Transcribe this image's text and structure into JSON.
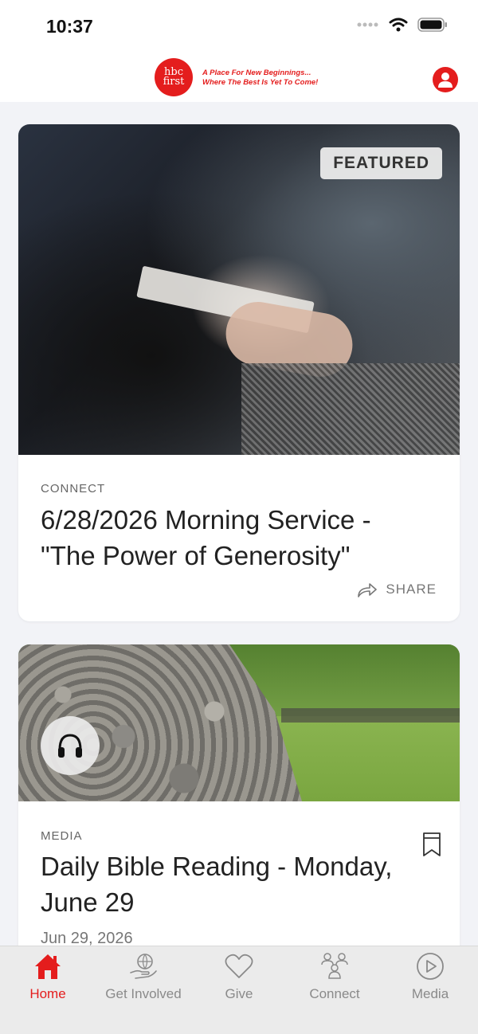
{
  "status_bar": {
    "time": "10:37"
  },
  "header": {
    "logo_text_line1": "hbc",
    "logo_text_line2": "first",
    "tagline_line1": "A Place For New Beginnings...",
    "tagline_line2": "Where The Best Is Yet To Come!",
    "profile_icon": "user-icon",
    "brand_color": "#e41d1d"
  },
  "cards": [
    {
      "badge": "FEATURED",
      "category": "CONNECT",
      "title_line1": "6/28/2026 Morning Service -",
      "title_line2": "\"The Power of Generosity\"",
      "share_label": "SHARE"
    },
    {
      "category": "MEDIA",
      "title_line1": "Daily Bible Reading - Monday,",
      "title_line2": "June 29",
      "date": "Jun 29, 2026",
      "media_icon": "headphones-icon",
      "bookmark_icon": "bookmark-icon"
    }
  ],
  "tabs": [
    {
      "label": "Home",
      "icon": "home-icon",
      "active": true
    },
    {
      "label": "Get Involved",
      "icon": "hand-globe-icon",
      "active": false
    },
    {
      "label": "Give",
      "icon": "heart-icon",
      "active": false
    },
    {
      "label": "Connect",
      "icon": "people-icon",
      "active": false
    },
    {
      "label": "Media",
      "icon": "play-icon",
      "active": false
    }
  ]
}
